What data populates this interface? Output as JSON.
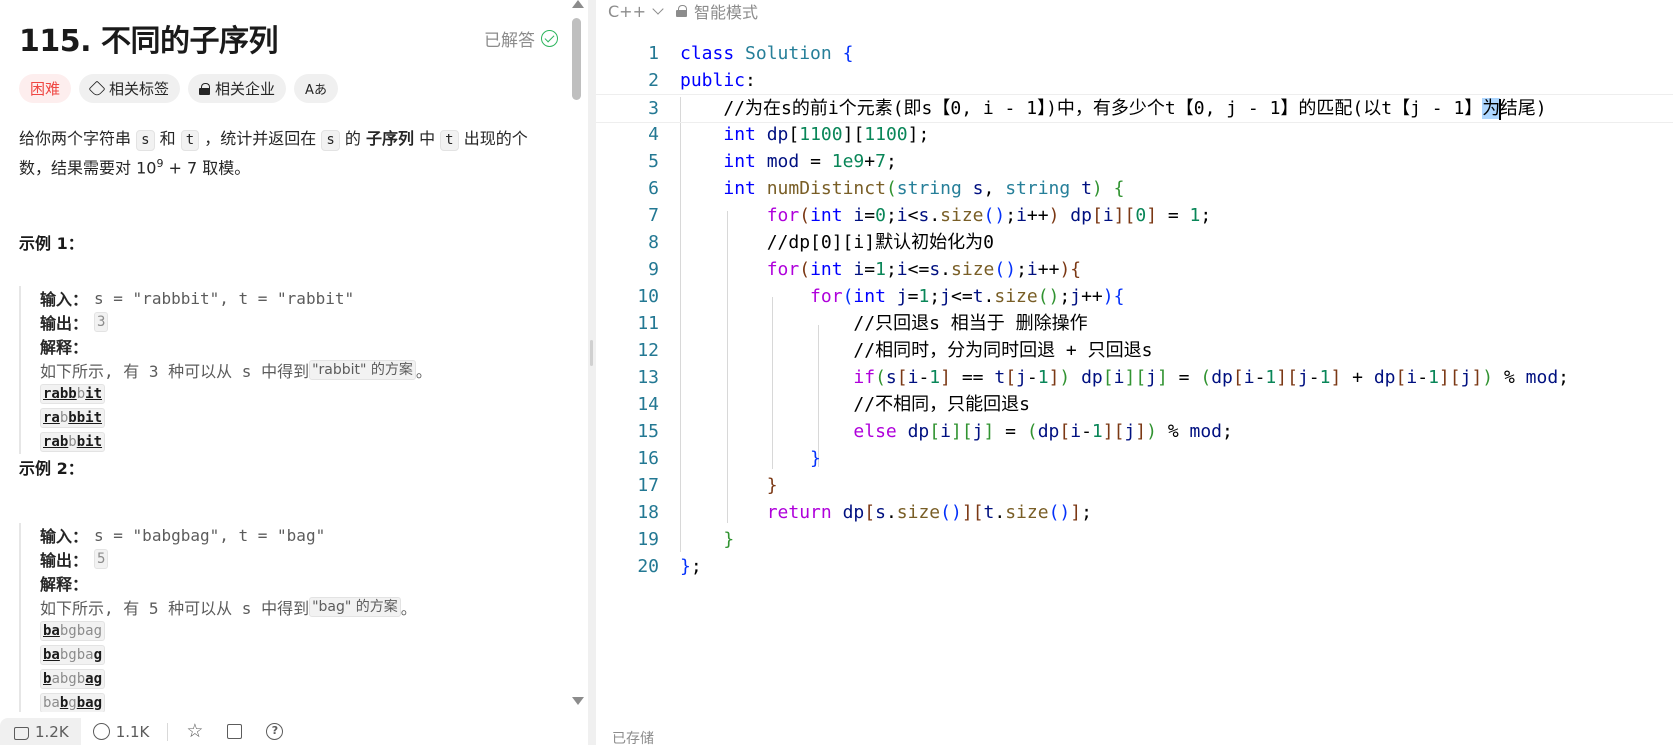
{
  "problem": {
    "title": "115. 不同的子序列",
    "status": "已解答",
    "tags": {
      "difficulty": "困难",
      "related_tags": "相关标签",
      "related_companies": "相关企业",
      "translate": "Aあ"
    },
    "desc": {
      "p1": "给你两个字符串 ",
      "s": "s",
      "and": " 和 ",
      "t": "t",
      "p2": " ，统计并返回在 ",
      "s2": "s",
      "p3": " 的 ",
      "bold": "子序列",
      "p4": " 中 ",
      "t2": "t",
      "p5": " 出现的个数，结果需要对 10",
      "sup": "9",
      "p6": " + 7 取模。"
    },
    "example1": {
      "title": "示例 1：",
      "input_label": "输入：",
      "input": "s = \"rabbbit\", t = \"rabbit\"",
      "output_label": "输出：",
      "output": "3",
      "explain_label": "解释：",
      "explain_pre": "如下所示, 有 3 种可以从 s 中得到 ",
      "explain_chip": "\"rabbit\" 的方案",
      "explain_post": "。",
      "seqs": [
        [
          "rabb",
          "b",
          "it"
        ],
        [
          "ra",
          "b",
          "bbit"
        ],
        [
          "rab",
          "b",
          "bit"
        ]
      ]
    },
    "example2": {
      "title": "示例 2：",
      "input_label": "输入：",
      "input": "s = \"babgbag\", t = \"bag\"",
      "output_label": "输出：",
      "output": "5",
      "explain_label": "解释：",
      "explain_pre": "如下所示, 有 5 种可以从 s 中得到 ",
      "explain_chip": "\"bag\" 的方案",
      "explain_post": "。",
      "seqs": [
        [
          "ba",
          "bgbag"
        ],
        [
          "ba",
          "bgba",
          "g"
        ],
        [
          "b",
          "abgb",
          "ag"
        ],
        [
          "ba",
          "b",
          "g",
          "bag"
        ]
      ]
    }
  },
  "bottom_bar": {
    "likes": "1.2K",
    "comments": "1.1K"
  },
  "editor": {
    "language": "C++",
    "mode": "智能模式",
    "saved_status": "已存储",
    "line_numbers": [
      "1",
      "2",
      "3",
      "4",
      "5",
      "6",
      "7",
      "8",
      "9",
      "10",
      "11",
      "12",
      "13",
      "14",
      "15",
      "16",
      "17",
      "18",
      "19",
      "20"
    ],
    "code_lines": [
      "class Solution {",
      "public:",
      "    //为在s的前i个元素(即s【0, i - 1】)中，有多少个t【0, j - 1】的匹配(以t【j - 1】为结尾)",
      "    int dp[1100][1100];",
      "    int mod = 1e9+7;",
      "    int numDistinct(string s, string t) {",
      "        for(int i=0;i<s.size();i++) dp[i][0] = 1;",
      "        //dp[0][i]默认初始化为0",
      "        for(int i=1;i<=s.size();i++){",
      "            for(int j=1;j<=t.size();j++){",
      "                //只回退s 相当于 删除操作",
      "                //相同时，分为同时回退 + 只回退s",
      "                if(s[i-1] == t[j-1]) dp[i][j] = (dp[i-1][j-1] + dp[i-1][j]) % mod;",
      "                //不相同，只能回退s",
      "                else dp[i][j] = (dp[i-1][j]) % mod;",
      "            }",
      "        }",
      "        return dp[s.size()][t.size()];",
      "    }",
      "};"
    ]
  }
}
